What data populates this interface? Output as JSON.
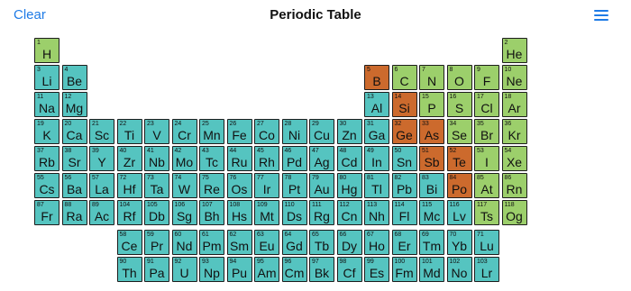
{
  "header": {
    "clear_label": "Clear",
    "title": "Periodic Table",
    "menu_icon": "hamburger-menu-icon"
  },
  "colors": {
    "metal": "#55c4c0",
    "nonmetal": "#9ccf6b",
    "metalloid": "#cc6a2d",
    "accent": "#1f7be6"
  },
  "elements": [
    {
      "n": "1",
      "s": "H",
      "t": "nonmetal",
      "r": 1,
      "c": 1
    },
    {
      "n": "2",
      "s": "He",
      "t": "nonmetal",
      "r": 1,
      "c": 18
    },
    {
      "n": "3",
      "s": "Li",
      "t": "metal",
      "r": 2,
      "c": 1
    },
    {
      "n": "4",
      "s": "Be",
      "t": "metal",
      "r": 2,
      "c": 2
    },
    {
      "n": "5",
      "s": "B",
      "t": "metalloid",
      "r": 2,
      "c": 13
    },
    {
      "n": "6",
      "s": "C",
      "t": "nonmetal",
      "r": 2,
      "c": 14
    },
    {
      "n": "7",
      "s": "N",
      "t": "nonmetal",
      "r": 2,
      "c": 15
    },
    {
      "n": "8",
      "s": "O",
      "t": "nonmetal",
      "r": 2,
      "c": 16
    },
    {
      "n": "9",
      "s": "F",
      "t": "nonmetal",
      "r": 2,
      "c": 17
    },
    {
      "n": "10",
      "s": "Ne",
      "t": "nonmetal",
      "r": 2,
      "c": 18
    },
    {
      "n": "11",
      "s": "Na",
      "t": "metal",
      "r": 3,
      "c": 1
    },
    {
      "n": "12",
      "s": "Mg",
      "t": "metal",
      "r": 3,
      "c": 2
    },
    {
      "n": "13",
      "s": "Al",
      "t": "metal",
      "r": 3,
      "c": 13
    },
    {
      "n": "14",
      "s": "Si",
      "t": "metalloid",
      "r": 3,
      "c": 14
    },
    {
      "n": "15",
      "s": "P",
      "t": "nonmetal",
      "r": 3,
      "c": 15
    },
    {
      "n": "16",
      "s": "S",
      "t": "nonmetal",
      "r": 3,
      "c": 16
    },
    {
      "n": "17",
      "s": "Cl",
      "t": "nonmetal",
      "r": 3,
      "c": 17
    },
    {
      "n": "18",
      "s": "Ar",
      "t": "nonmetal",
      "r": 3,
      "c": 18
    },
    {
      "n": "19",
      "s": "K",
      "t": "metal",
      "r": 4,
      "c": 1
    },
    {
      "n": "20",
      "s": "Ca",
      "t": "metal",
      "r": 4,
      "c": 2
    },
    {
      "n": "21",
      "s": "Sc",
      "t": "metal",
      "r": 4,
      "c": 3
    },
    {
      "n": "22",
      "s": "Ti",
      "t": "metal",
      "r": 4,
      "c": 4
    },
    {
      "n": "23",
      "s": "V",
      "t": "metal",
      "r": 4,
      "c": 5
    },
    {
      "n": "24",
      "s": "Cr",
      "t": "metal",
      "r": 4,
      "c": 6
    },
    {
      "n": "25",
      "s": "Mn",
      "t": "metal",
      "r": 4,
      "c": 7
    },
    {
      "n": "26",
      "s": "Fe",
      "t": "metal",
      "r": 4,
      "c": 8
    },
    {
      "n": "27",
      "s": "Co",
      "t": "metal",
      "r": 4,
      "c": 9
    },
    {
      "n": "28",
      "s": "Ni",
      "t": "metal",
      "r": 4,
      "c": 10
    },
    {
      "n": "29",
      "s": "Cu",
      "t": "metal",
      "r": 4,
      "c": 11
    },
    {
      "n": "30",
      "s": "Zn",
      "t": "metal",
      "r": 4,
      "c": 12
    },
    {
      "n": "31",
      "s": "Ga",
      "t": "metal",
      "r": 4,
      "c": 13
    },
    {
      "n": "32",
      "s": "Ge",
      "t": "metalloid",
      "r": 4,
      "c": 14
    },
    {
      "n": "33",
      "s": "As",
      "t": "metalloid",
      "r": 4,
      "c": 15
    },
    {
      "n": "34",
      "s": "Se",
      "t": "nonmetal",
      "r": 4,
      "c": 16
    },
    {
      "n": "35",
      "s": "Br",
      "t": "nonmetal",
      "r": 4,
      "c": 17
    },
    {
      "n": "36",
      "s": "Kr",
      "t": "nonmetal",
      "r": 4,
      "c": 18
    },
    {
      "n": "37",
      "s": "Rb",
      "t": "metal",
      "r": 5,
      "c": 1
    },
    {
      "n": "38",
      "s": "Sr",
      "t": "metal",
      "r": 5,
      "c": 2
    },
    {
      "n": "39",
      "s": "Y",
      "t": "metal",
      "r": 5,
      "c": 3
    },
    {
      "n": "40",
      "s": "Zr",
      "t": "metal",
      "r": 5,
      "c": 4
    },
    {
      "n": "41",
      "s": "Nb",
      "t": "metal",
      "r": 5,
      "c": 5
    },
    {
      "n": "42",
      "s": "Mo",
      "t": "metal",
      "r": 5,
      "c": 6
    },
    {
      "n": "43",
      "s": "Tc",
      "t": "metal",
      "r": 5,
      "c": 7
    },
    {
      "n": "44",
      "s": "Ru",
      "t": "metal",
      "r": 5,
      "c": 8
    },
    {
      "n": "45",
      "s": "Rh",
      "t": "metal",
      "r": 5,
      "c": 9
    },
    {
      "n": "46",
      "s": "Pd",
      "t": "metal",
      "r": 5,
      "c": 10
    },
    {
      "n": "47",
      "s": "Ag",
      "t": "metal",
      "r": 5,
      "c": 11
    },
    {
      "n": "48",
      "s": "Cd",
      "t": "metal",
      "r": 5,
      "c": 12
    },
    {
      "n": "49",
      "s": "In",
      "t": "metal",
      "r": 5,
      "c": 13
    },
    {
      "n": "50",
      "s": "Sn",
      "t": "metal",
      "r": 5,
      "c": 14
    },
    {
      "n": "51",
      "s": "Sb",
      "t": "metalloid",
      "r": 5,
      "c": 15
    },
    {
      "n": "52",
      "s": "Te",
      "t": "metalloid",
      "r": 5,
      "c": 16
    },
    {
      "n": "53",
      "s": "I",
      "t": "nonmetal",
      "r": 5,
      "c": 17
    },
    {
      "n": "54",
      "s": "Xe",
      "t": "nonmetal",
      "r": 5,
      "c": 18
    },
    {
      "n": "55",
      "s": "Cs",
      "t": "metal",
      "r": 6,
      "c": 1
    },
    {
      "n": "56",
      "s": "Ba",
      "t": "metal",
      "r": 6,
      "c": 2
    },
    {
      "n": "57",
      "s": "La",
      "t": "metal",
      "r": 6,
      "c": 3
    },
    {
      "n": "72",
      "s": "Hf",
      "t": "metal",
      "r": 6,
      "c": 4
    },
    {
      "n": "73",
      "s": "Ta",
      "t": "metal",
      "r": 6,
      "c": 5
    },
    {
      "n": "74",
      "s": "W",
      "t": "metal",
      "r": 6,
      "c": 6
    },
    {
      "n": "75",
      "s": "Re",
      "t": "metal",
      "r": 6,
      "c": 7
    },
    {
      "n": "76",
      "s": "Os",
      "t": "metal",
      "r": 6,
      "c": 8
    },
    {
      "n": "77",
      "s": "Ir",
      "t": "metal",
      "r": 6,
      "c": 9
    },
    {
      "n": "78",
      "s": "Pt",
      "t": "metal",
      "r": 6,
      "c": 10
    },
    {
      "n": "79",
      "s": "Au",
      "t": "metal",
      "r": 6,
      "c": 11
    },
    {
      "n": "80",
      "s": "Hg",
      "t": "metal",
      "r": 6,
      "c": 12
    },
    {
      "n": "81",
      "s": "Tl",
      "t": "metal",
      "r": 6,
      "c": 13
    },
    {
      "n": "82",
      "s": "Pb",
      "t": "metal",
      "r": 6,
      "c": 14
    },
    {
      "n": "83",
      "s": "Bi",
      "t": "metal",
      "r": 6,
      "c": 15
    },
    {
      "n": "84",
      "s": "Po",
      "t": "metalloid",
      "r": 6,
      "c": 16
    },
    {
      "n": "85",
      "s": "At",
      "t": "nonmetal",
      "r": 6,
      "c": 17
    },
    {
      "n": "86",
      "s": "Rn",
      "t": "nonmetal",
      "r": 6,
      "c": 18
    },
    {
      "n": "87",
      "s": "Fr",
      "t": "metal",
      "r": 7,
      "c": 1
    },
    {
      "n": "88",
      "s": "Ra",
      "t": "metal",
      "r": 7,
      "c": 2
    },
    {
      "n": "89",
      "s": "Ac",
      "t": "metal",
      "r": 7,
      "c": 3
    },
    {
      "n": "104",
      "s": "Rf",
      "t": "metal",
      "r": 7,
      "c": 4
    },
    {
      "n": "105",
      "s": "Db",
      "t": "metal",
      "r": 7,
      "c": 5
    },
    {
      "n": "106",
      "s": "Sg",
      "t": "metal",
      "r": 7,
      "c": 6
    },
    {
      "n": "107",
      "s": "Bh",
      "t": "metal",
      "r": 7,
      "c": 7
    },
    {
      "n": "108",
      "s": "Hs",
      "t": "metal",
      "r": 7,
      "c": 8
    },
    {
      "n": "109",
      "s": "Mt",
      "t": "metal",
      "r": 7,
      "c": 9
    },
    {
      "n": "110",
      "s": "Ds",
      "t": "metal",
      "r": 7,
      "c": 10
    },
    {
      "n": "111",
      "s": "Rg",
      "t": "metal",
      "r": 7,
      "c": 11
    },
    {
      "n": "112",
      "s": "Cn",
      "t": "metal",
      "r": 7,
      "c": 12
    },
    {
      "n": "113",
      "s": "Nh",
      "t": "metal",
      "r": 7,
      "c": 13
    },
    {
      "n": "114",
      "s": "Fl",
      "t": "metal",
      "r": 7,
      "c": 14
    },
    {
      "n": "115",
      "s": "Mc",
      "t": "metal",
      "r": 7,
      "c": 15
    },
    {
      "n": "116",
      "s": "Lv",
      "t": "metal",
      "r": 7,
      "c": 16
    },
    {
      "n": "117",
      "s": "Ts",
      "t": "nonmetal",
      "r": 7,
      "c": 17
    },
    {
      "n": "118",
      "s": "Og",
      "t": "nonmetal",
      "r": 7,
      "c": 18
    },
    {
      "n": "58",
      "s": "Ce",
      "t": "metal",
      "r": 9,
      "c": 4
    },
    {
      "n": "59",
      "s": "Pr",
      "t": "metal",
      "r": 9,
      "c": 5
    },
    {
      "n": "60",
      "s": "Nd",
      "t": "metal",
      "r": 9,
      "c": 6
    },
    {
      "n": "61",
      "s": "Pm",
      "t": "metal",
      "r": 9,
      "c": 7
    },
    {
      "n": "62",
      "s": "Sm",
      "t": "metal",
      "r": 9,
      "c": 8
    },
    {
      "n": "63",
      "s": "Eu",
      "t": "metal",
      "r": 9,
      "c": 9
    },
    {
      "n": "64",
      "s": "Gd",
      "t": "metal",
      "r": 9,
      "c": 10
    },
    {
      "n": "65",
      "s": "Tb",
      "t": "metal",
      "r": 9,
      "c": 11
    },
    {
      "n": "66",
      "s": "Dy",
      "t": "metal",
      "r": 9,
      "c": 12
    },
    {
      "n": "67",
      "s": "Ho",
      "t": "metal",
      "r": 9,
      "c": 13
    },
    {
      "n": "68",
      "s": "Er",
      "t": "metal",
      "r": 9,
      "c": 14
    },
    {
      "n": "69",
      "s": "Tm",
      "t": "metal",
      "r": 9,
      "c": 15
    },
    {
      "n": "70",
      "s": "Yb",
      "t": "metal",
      "r": 9,
      "c": 16
    },
    {
      "n": "71",
      "s": "Lu",
      "t": "metal",
      "r": 9,
      "c": 17
    },
    {
      "n": "90",
      "s": "Th",
      "t": "metal",
      "r": 10,
      "c": 4
    },
    {
      "n": "91",
      "s": "Pa",
      "t": "metal",
      "r": 10,
      "c": 5
    },
    {
      "n": "92",
      "s": "U",
      "t": "metal",
      "r": 10,
      "c": 6
    },
    {
      "n": "93",
      "s": "Np",
      "t": "metal",
      "r": 10,
      "c": 7
    },
    {
      "n": "94",
      "s": "Pu",
      "t": "metal",
      "r": 10,
      "c": 8
    },
    {
      "n": "95",
      "s": "Am",
      "t": "metal",
      "r": 10,
      "c": 9
    },
    {
      "n": "96",
      "s": "Cm",
      "t": "metal",
      "r": 10,
      "c": 10
    },
    {
      "n": "97",
      "s": "Bk",
      "t": "metal",
      "r": 10,
      "c": 11
    },
    {
      "n": "98",
      "s": "Cf",
      "t": "metal",
      "r": 10,
      "c": 12
    },
    {
      "n": "99",
      "s": "Es",
      "t": "metal",
      "r": 10,
      "c": 13
    },
    {
      "n": "100",
      "s": "Fm",
      "t": "metal",
      "r": 10,
      "c": 14
    },
    {
      "n": "101",
      "s": "Md",
      "t": "metal",
      "r": 10,
      "c": 15
    },
    {
      "n": "102",
      "s": "No",
      "t": "metal",
      "r": 10,
      "c": 16
    },
    {
      "n": "103",
      "s": "Lr",
      "t": "metal",
      "r": 10,
      "c": 17
    }
  ]
}
